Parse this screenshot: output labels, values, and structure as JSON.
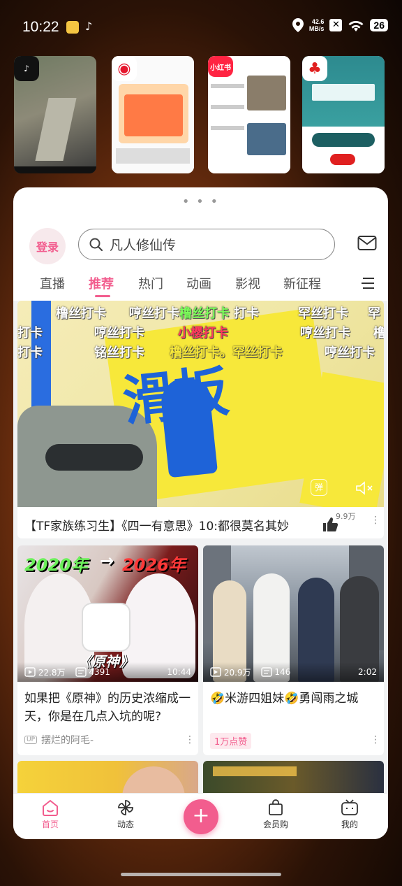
{
  "status_bar": {
    "time": "10:22",
    "net_speed_value": "42.6",
    "net_speed_unit": "MB/s",
    "battery": "26"
  },
  "recent_apps": [
    {
      "name": "抖音",
      "badge_icon": "tiktok-icon",
      "color": "#111111"
    },
    {
      "name": "微博",
      "badge_icon": "weibo-icon",
      "color": "#e6162d"
    },
    {
      "name": "小红书",
      "badge_icon": "xiaohongshu-icon",
      "color": "#ff2442"
    },
    {
      "name": "安兔兔",
      "badge_icon": "antutu-icon",
      "color": "#e02020"
    }
  ],
  "header": {
    "login_label": "登录",
    "search_placeholder": "凡人修仙传"
  },
  "tabs": [
    {
      "label": "直播",
      "active": false
    },
    {
      "label": "推荐",
      "active": true
    },
    {
      "label": "热门",
      "active": false
    },
    {
      "label": "动画",
      "active": false
    },
    {
      "label": "影视",
      "active": false
    },
    {
      "label": "新征程",
      "active": false
    }
  ],
  "hero_video": {
    "title": "【TF家族练习生】《四一有意思》10:都很莫名其妙",
    "likes": "9.9万",
    "artwork_text": "滑板",
    "danmaku": [
      "橹丝打卡",
      "哼丝打卡",
      "橹丝打卡",
      "打卡",
      "罕丝打卡",
      "罕",
      "打卡",
      "哼丝打卡",
      "小樱打卡",
      "哼丝打卡",
      "橹",
      "铭丝打卡",
      "橹丝打卡。罕丝打卡",
      "哼丝打卡",
      "打卡"
    ]
  },
  "cards": [
    {
      "title": "如果把《原神》的历史浓缩成一天，你是在几点入坑的呢?",
      "views": "22.8万",
      "comments": "4391",
      "duration": "10:44",
      "author": "摆烂的阿毛-",
      "tag": "",
      "overlay_left": "2020年",
      "overlay_arrow": "→",
      "overlay_right": "2026年",
      "overlay_game": "《原神》"
    },
    {
      "title": "🤣米游四姐妹🤣勇闯雨之城",
      "views": "20.9万",
      "comments": "146",
      "duration": "2:02",
      "author": "",
      "tag": "1万点赞"
    }
  ],
  "bottom_nav": {
    "home": "首页",
    "dynamic": "动态",
    "plus": "+",
    "vip_shop": "会员购",
    "me": "我的"
  },
  "colors": {
    "accent": "#f25d8e",
    "feed_bg": "#f1f2f3"
  }
}
